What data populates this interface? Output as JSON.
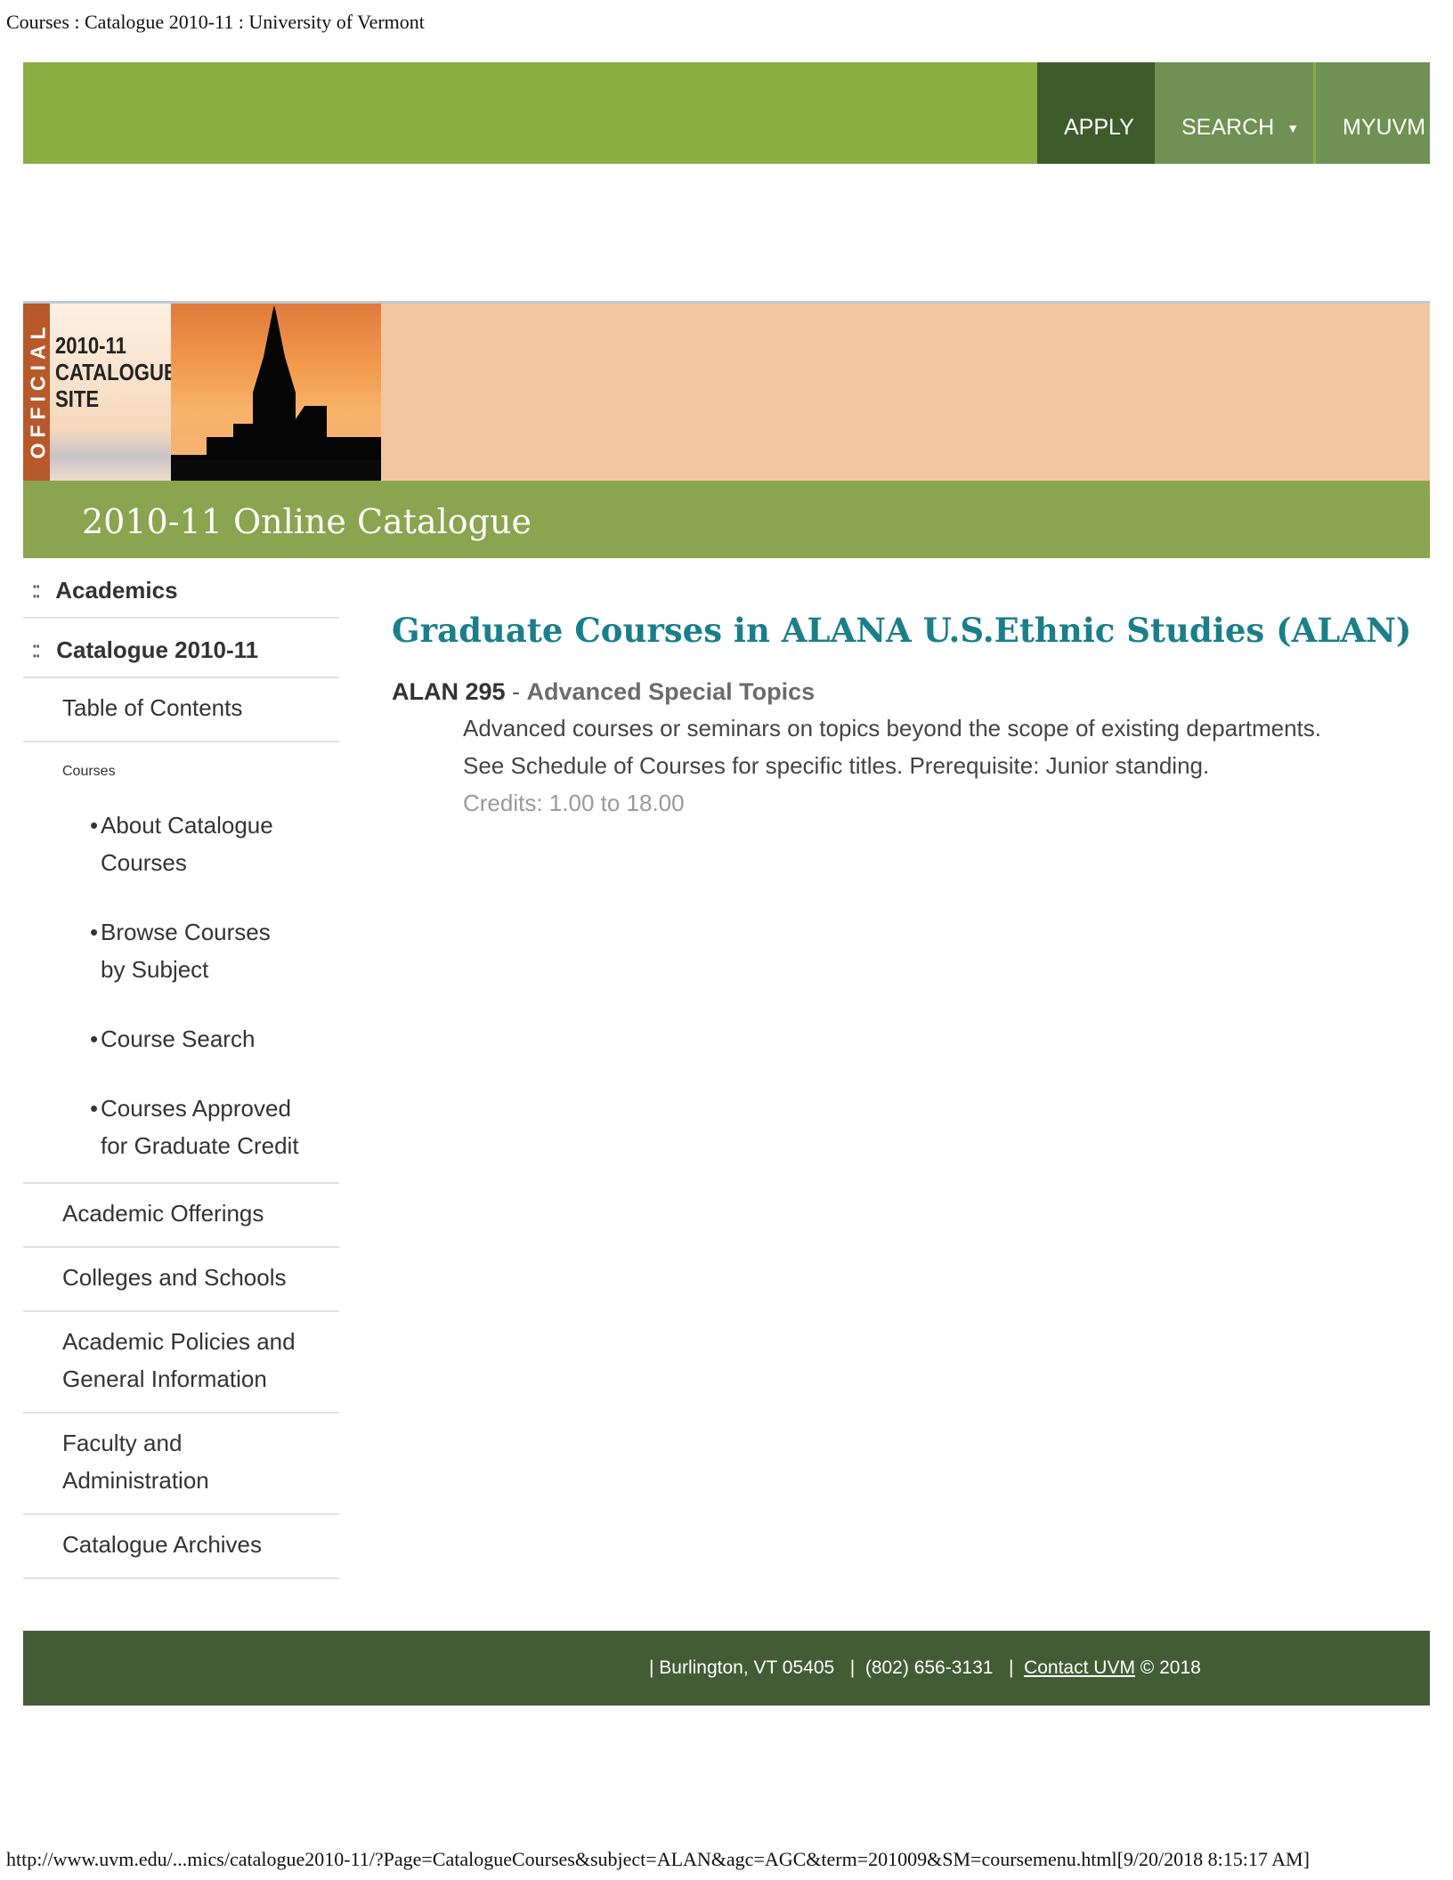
{
  "page_header": "Courses : Catalogue 2010-11 : University of Vermont",
  "top_nav": {
    "apply": "APPLY",
    "search": "SEARCH",
    "search_caret": "▼",
    "myuvm": "MYUVM"
  },
  "banner": {
    "official": "OFFICIAL",
    "lines": [
      "2010-11",
      "CATALOGUE",
      "SITE"
    ],
    "colors": {
      "bg": "#f1c69f",
      "official": "#b8592b"
    }
  },
  "catalogue_title": "2010-11 Online Catalogue",
  "sidebar": {
    "academics": "Academics",
    "catalogue": "Catalogue 2010-11",
    "table_of_contents": "Table of Contents",
    "courses": "Courses",
    "sub": {
      "about_1": "About Catalogue",
      "about_2": "Courses",
      "browse_1": "Browse Courses",
      "browse_2": "by Subject",
      "search": "Course Search",
      "approved_1": "Courses Approved",
      "approved_2": "for Graduate Credit"
    },
    "academic_offerings": "Academic Offerings",
    "colleges": "Colleges and Schools",
    "policies_1": "Academic Policies and",
    "policies_2": "General Information",
    "faculty_1": "Faculty and",
    "faculty_2": "Administration",
    "archives": "Catalogue Archives"
  },
  "main": {
    "title": "Graduate Courses in ALANA U.S.Ethnic Studies (ALAN)",
    "course": {
      "code": "ALAN 295",
      "separator": " - ",
      "name": "Advanced Special Topics",
      "description": "Advanced courses or seminars on topics beyond the scope of existing departments. See Schedule of Courses for specific titles. Prerequisite: Junior standing.",
      "credits": "Credits: 1.00 to 18.00"
    }
  },
  "footer": {
    "prefix": "| Burlington, VT 05405   |  (802) 656-3131   |  ",
    "contact_link": "Contact UVM",
    "suffix": " © 2018"
  },
  "url_footer": "http://www.uvm.edu/...mics/catalogue2010-11/?Page=CatalogueCourses&subject=ALAN&agc=AGC&term=201009&SM=coursemenu.html[9/20/2018 8:15:17 AM]",
  "colors": {
    "topbar": "#8aae42",
    "apply_bg": "#3e5b2c",
    "catbar": "#8aa44f",
    "title_teal": "#1a7f8a",
    "footer": "#425c35"
  }
}
